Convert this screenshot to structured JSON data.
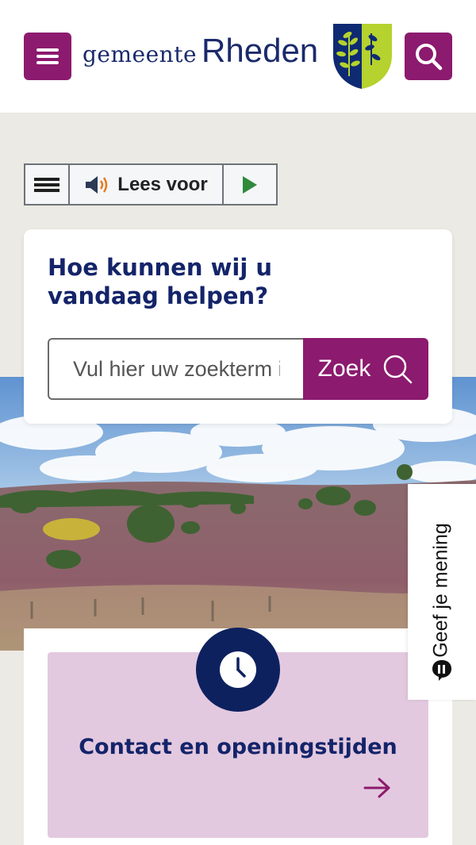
{
  "header": {
    "menu_icon": "hamburger-icon",
    "logo_small": "gemeente",
    "logo_big": "Rheden",
    "crest_icon": "municipal-crest-icon",
    "search_icon": "search-icon",
    "brand_color": "#8c1a6e"
  },
  "readspeaker": {
    "menu_icon": "hamburger-icon",
    "speaker_icon": "speaker-icon",
    "label": "Lees voor",
    "play_icon": "play-icon"
  },
  "search": {
    "title": "Hoe kunnen wij u vandaag helpen?",
    "placeholder": "Vul hier uw zoekterm in",
    "button_label": "Zoek",
    "button_icon": "search-icon"
  },
  "feedback": {
    "label": "Geef je mening",
    "icon": "speech-bubble-icon"
  },
  "contact": {
    "icon": "clock-icon",
    "title": "Contact en openingstijden",
    "arrow_icon": "arrow-right-icon",
    "tile_color": "#e3c9df"
  },
  "colors": {
    "navy": "#14246a",
    "background": "#ebeae4"
  }
}
